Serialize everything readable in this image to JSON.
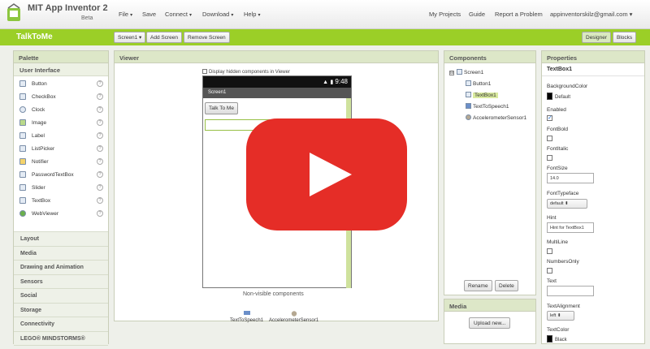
{
  "header": {
    "brand": "MIT App Inventor 2",
    "beta": "Beta",
    "menus": [
      {
        "label": "File",
        "caret": "▾"
      },
      {
        "label": "Save",
        "caret": ""
      },
      {
        "label": "Connect",
        "caret": "▾"
      },
      {
        "label": "Download",
        "caret": "▾"
      },
      {
        "label": "Help",
        "caret": "▾"
      }
    ],
    "right_links": [
      "My Projects",
      "Guide",
      "Report a Problem"
    ],
    "account": "appinventorskilz@gmail.com ▾"
  },
  "project": {
    "name": "TalkToMe",
    "screen_select": "Screen1 ▾",
    "add_screen": "Add Screen",
    "remove_screen": "Remove Screen",
    "designer": "Designer",
    "blocks": "Blocks"
  },
  "palette": {
    "title": "Palette",
    "section": "User Interface",
    "items": [
      "Button",
      "CheckBox",
      "Clock",
      "Image",
      "Label",
      "ListPicker",
      "Notifier",
      "PasswordTextBox",
      "Slider",
      "TextBox",
      "WebViewer"
    ],
    "help_glyph": "?",
    "categories": [
      "Layout",
      "Media",
      "Drawing and Animation",
      "Sensors",
      "Social",
      "Storage",
      "Connectivity",
      "LEGO® MINDSTORMS®"
    ]
  },
  "viewer": {
    "title": "Viewer",
    "display_hidden": "Display hidden components in Viewer",
    "clock": "9:48",
    "screen_title": "Screen1",
    "button_label": "Talk To Me",
    "nonvisible_title": "Non-visible components",
    "nonvisible": [
      "TextToSpeech1",
      "AccelerometerSensor1"
    ]
  },
  "components": {
    "title": "Components",
    "toggle": "⊟",
    "root": "Screen1",
    "children": [
      "Button1",
      "TextBox1",
      "TextToSpeech1",
      "AccelerometerSensor1"
    ],
    "rename": "Rename",
    "delete": "Delete"
  },
  "media": {
    "title": "Media",
    "upload": "Upload new..."
  },
  "properties": {
    "title": "Properties",
    "component": "TextBox1",
    "background_color": {
      "label": "BackgroundColor",
      "value": "Default",
      "color": "#000000"
    },
    "enabled": {
      "label": "Enabled",
      "checked": "✓"
    },
    "font_bold": "FontBold",
    "font_italic": "FontItalic",
    "font_size": {
      "label": "FontSize",
      "value": "14.0"
    },
    "font_typeface": {
      "label": "FontTypeface",
      "value": "default ⬍"
    },
    "hint": {
      "label": "Hint",
      "value": "Hint for TextBox1"
    },
    "multiline": "MultiLine",
    "numbers_only": "NumbersOnly",
    "text": "Text",
    "text_alignment": {
      "label": "TextAlignment",
      "value": "left ⬍"
    },
    "text_color": {
      "label": "TextColor",
      "value": "Black",
      "color": "#000000"
    }
  },
  "overlay": {
    "icon": "youtube-play-icon",
    "color": "#e52d27"
  },
  "colors": {
    "accent": "#9bcf27",
    "panel_header": "#dde7c8"
  }
}
